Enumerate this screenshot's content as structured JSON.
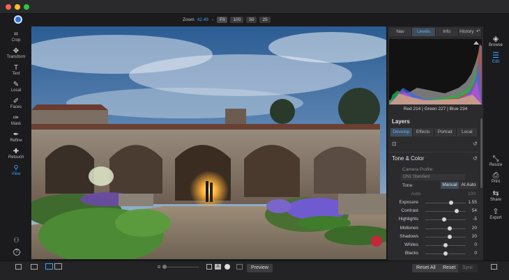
{
  "zoom": {
    "label": "Zoom",
    "value": "42.49",
    "presets": [
      "Fit",
      "100",
      "50",
      "25"
    ]
  },
  "left_tools": [
    {
      "label": "Crop",
      "icon": "crop-icon",
      "glyph": "⌗"
    },
    {
      "label": "Transform",
      "icon": "transform-icon",
      "glyph": "✥"
    },
    {
      "label": "Text",
      "icon": "text-icon",
      "glyph": "T"
    },
    {
      "label": "Local",
      "icon": "local-brush-icon",
      "glyph": "✎"
    },
    {
      "label": "Faces",
      "icon": "faces-icon",
      "glyph": "✐"
    },
    {
      "label": "Mask",
      "icon": "mask-icon",
      "glyph": "✑"
    },
    {
      "label": "Refine",
      "icon": "refine-icon",
      "glyph": "✒"
    },
    {
      "label": "Retouch",
      "icon": "retouch-icon",
      "glyph": "✚"
    },
    {
      "label": "View",
      "icon": "view-icon",
      "glyph": "⚲"
    }
  ],
  "top_tabs": [
    "Nav",
    "Levels",
    "Info",
    "History"
  ],
  "histogram_readout": "Red 214 | Green 227 | Blue 234",
  "layers_title": "Layers",
  "module_tabs": [
    "Develop",
    "Effects",
    "Portrait",
    "Local"
  ],
  "tone_color": {
    "title": "Tone & Color",
    "camera_profile_label": "Camera Profile:",
    "camera_profile_value": "ON1 Standard",
    "tone_label": "Tone:",
    "tone_manual": "Manual",
    "tone_ai": "AI Auto",
    "auto_label": "Auto",
    "auto_value": "100"
  },
  "sliders": [
    {
      "label": "Exposure",
      "value": "1.55",
      "pos": 0.64
    },
    {
      "label": "Contrast",
      "value": "54",
      "pos": 0.77
    },
    {
      "label": "Highlights",
      "value": "-5",
      "pos": 0.47
    },
    {
      "label": "Midtones",
      "value": "20",
      "pos": 0.6
    },
    {
      "label": "Shadows",
      "value": "20",
      "pos": 0.6
    },
    {
      "label": "Whites",
      "value": "0",
      "pos": 0.5
    },
    {
      "label": "Blacks",
      "value": "0",
      "pos": 0.5
    }
  ],
  "right_tools": [
    {
      "label": "Browse",
      "icon": "browse-icon",
      "glyph": "◈",
      "active": false
    },
    {
      "label": "Edit",
      "icon": "edit-sliders-icon",
      "glyph": "☰",
      "active": true
    },
    {
      "label": "Resize",
      "icon": "resize-icon",
      "glyph": "⤡",
      "active": false
    },
    {
      "label": "Print",
      "icon": "print-icon",
      "glyph": "⎙",
      "active": false
    },
    {
      "label": "Share",
      "icon": "share-icon",
      "glyph": "⇆",
      "active": false
    },
    {
      "label": "Export",
      "icon": "export-icon",
      "glyph": "⇪",
      "active": false
    }
  ],
  "bottom": {
    "preview": "Preview",
    "reset_all": "Reset All",
    "reset": "Reset",
    "sync": "Sync"
  },
  "colors": {
    "accent": "#3aa0ff",
    "panel": "#2b2b2e",
    "background": "#1b1b1d"
  }
}
